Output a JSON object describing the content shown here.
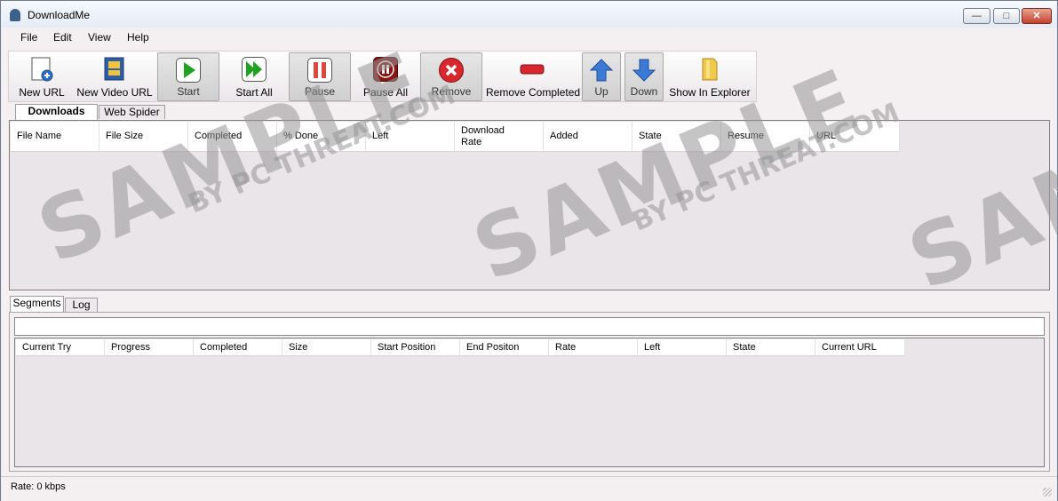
{
  "window": {
    "title": "DownloadMe",
    "minimize": "—",
    "maximize": "□",
    "close": "✕"
  },
  "menu": [
    "File",
    "Edit",
    "View",
    "Help"
  ],
  "toolbar": [
    {
      "label": "New URL",
      "icon": "new-url-icon"
    },
    {
      "label": "New Video URL",
      "icon": "new-video-url-icon"
    },
    {
      "label": "Start",
      "icon": "play-icon"
    },
    {
      "label": "Start All",
      "icon": "play-all-icon"
    },
    {
      "label": "Pause",
      "icon": "pause-icon"
    },
    {
      "label": "Pause All",
      "icon": "pause-all-icon"
    },
    {
      "label": "Remove",
      "icon": "remove-icon"
    },
    {
      "label": "Remove Completed",
      "icon": "remove-completed-icon"
    },
    {
      "label": "Up",
      "icon": "arrow-up-icon"
    },
    {
      "label": "Down",
      "icon": "arrow-down-icon"
    },
    {
      "label": "Show In Explorer",
      "icon": "folder-icon"
    }
  ],
  "main_tabs": [
    "Downloads",
    "Web Spider"
  ],
  "downloads_columns": [
    "File Name",
    "File Size",
    "Completed",
    "% Done",
    "Left",
    "Download Rate",
    "Added",
    "State",
    "Resume",
    "URL"
  ],
  "bottom_tabs": [
    "Segments",
    "Log"
  ],
  "segments_columns": [
    "Current Try",
    "Progress",
    "Completed",
    "Size",
    "Start Position",
    "End Positon",
    "Rate",
    "Left",
    "State",
    "Current URL"
  ],
  "status": {
    "rate": "Rate:  0 kbps"
  },
  "watermark": {
    "main": "SAMPLE",
    "sub": "BY PC THREAT.COM"
  },
  "colors": {
    "play": "#1fa21f",
    "pause": "#d9332a",
    "remove": "#d8262c",
    "arrow": "#3b7bd6",
    "folder": "#f1c94a"
  }
}
